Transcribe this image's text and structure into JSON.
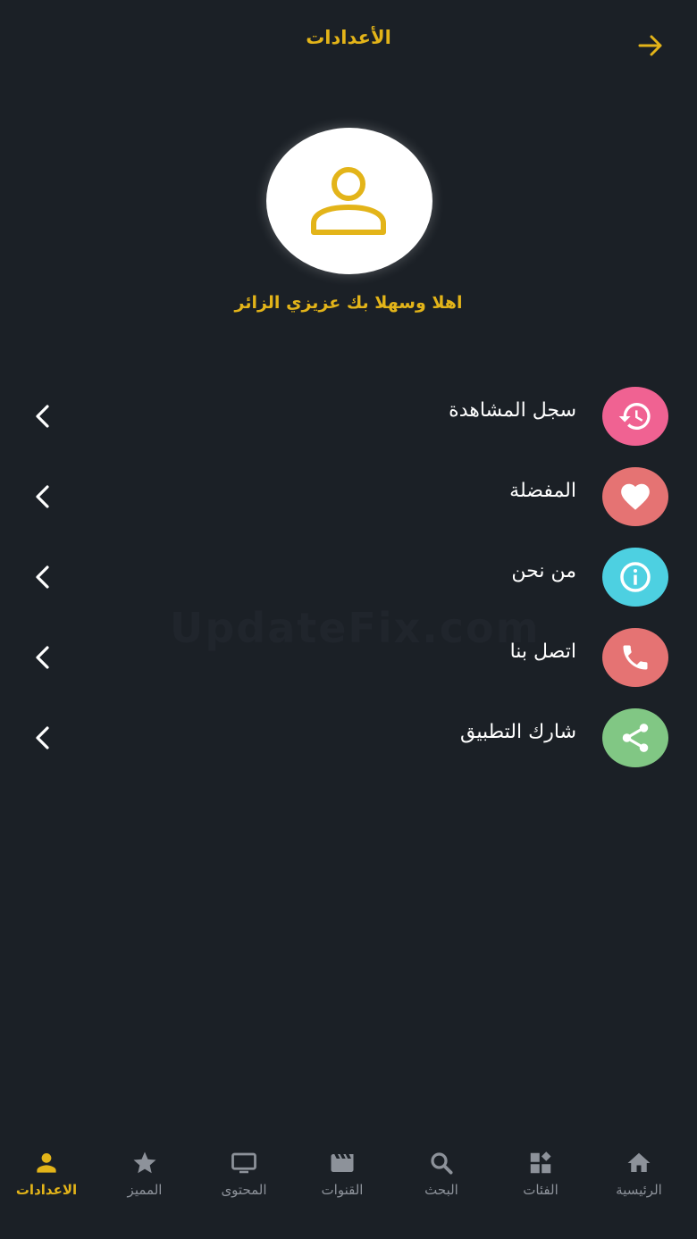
{
  "header": {
    "title": "الأعدادات"
  },
  "profile": {
    "welcome": "اهلا وسهلا بك عزيزي الزائر"
  },
  "menu": [
    {
      "label": "سجل المشاهدة",
      "icon": "history-icon",
      "color": "#f06292"
    },
    {
      "label": "المفضلة",
      "icon": "heart-icon",
      "color": "#e57373"
    },
    {
      "label": "من نحن",
      "icon": "info-icon",
      "color": "#4dd0e1"
    },
    {
      "label": "اتصل بنا",
      "icon": "phone-icon",
      "color": "#e57373"
    },
    {
      "label": "شارك التطبيق",
      "icon": "share-icon",
      "color": "#81c784"
    }
  ],
  "watermark": "UpdateFix.com",
  "nav": [
    {
      "label": "الرئيسية",
      "icon": "home-icon"
    },
    {
      "label": "الفئات",
      "icon": "categories-icon"
    },
    {
      "label": "البحث",
      "icon": "search-icon"
    },
    {
      "label": "القنوات",
      "icon": "channels-icon"
    },
    {
      "label": "المحتوى",
      "icon": "tv-icon"
    },
    {
      "label": "المميز",
      "icon": "star-icon"
    },
    {
      "label": "الاعدادات",
      "icon": "profile-icon",
      "active": true
    }
  ],
  "colors": {
    "accent": "#e3b419",
    "background": "#1b2026",
    "inactive": "#8d929a"
  }
}
